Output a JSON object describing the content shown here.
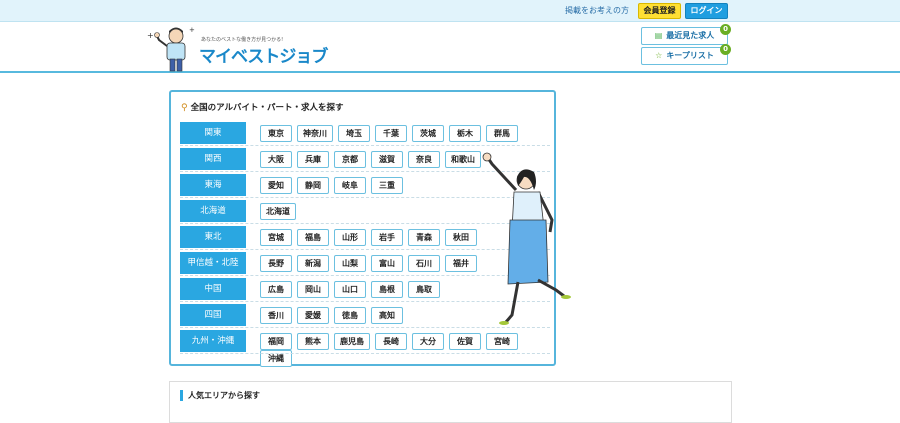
{
  "topbar": {
    "advertise_link": "掲載をお考えの方",
    "member_button": "会員登録",
    "login_button": "ログイン"
  },
  "header": {
    "logo_tagline": "あなたのベストな働き方が見つかる!",
    "logo_text": "マイベストジョブ",
    "recent_button": "最近見た求人",
    "recent_count": "0",
    "keep_button": "キープリスト",
    "keep_count": "0"
  },
  "search": {
    "title": "全国のアルバイト・パート・求人を探す",
    "regions": [
      {
        "label": "関東",
        "prefs": [
          "東京",
          "神奈川",
          "埼玉",
          "千葉",
          "茨城",
          "栃木",
          "群馬"
        ]
      },
      {
        "label": "関西",
        "prefs": [
          "大阪",
          "兵庫",
          "京都",
          "滋賀",
          "奈良",
          "和歌山"
        ]
      },
      {
        "label": "東海",
        "prefs": [
          "愛知",
          "静岡",
          "岐阜",
          "三重"
        ]
      },
      {
        "label": "北海道",
        "prefs": [
          "北海道"
        ]
      },
      {
        "label": "東北",
        "prefs": [
          "宮城",
          "福島",
          "山形",
          "岩手",
          "青森",
          "秋田"
        ]
      },
      {
        "label": "甲信越・北陸",
        "prefs": [
          "長野",
          "新潟",
          "山梨",
          "富山",
          "石川",
          "福井"
        ]
      },
      {
        "label": "中国",
        "prefs": [
          "広島",
          "岡山",
          "山口",
          "島根",
          "鳥取"
        ]
      },
      {
        "label": "四国",
        "prefs": [
          "香川",
          "愛媛",
          "徳島",
          "高知"
        ]
      },
      {
        "label": "九州・沖縄",
        "prefs": [
          "福岡",
          "熊本",
          "鹿児島",
          "長崎",
          "大分",
          "佐賀",
          "宮崎",
          "沖縄"
        ]
      }
    ]
  },
  "popular": {
    "title": "人気エリアから探す"
  },
  "colors": {
    "accent": "#2aa7e1",
    "member_yellow": "#ffe033",
    "login_blue": "#1f9ee0",
    "badge_green": "#6aae24"
  },
  "icons": {
    "recent": "document-icon",
    "keep": "star-icon",
    "search": "magnifier-icon"
  }
}
